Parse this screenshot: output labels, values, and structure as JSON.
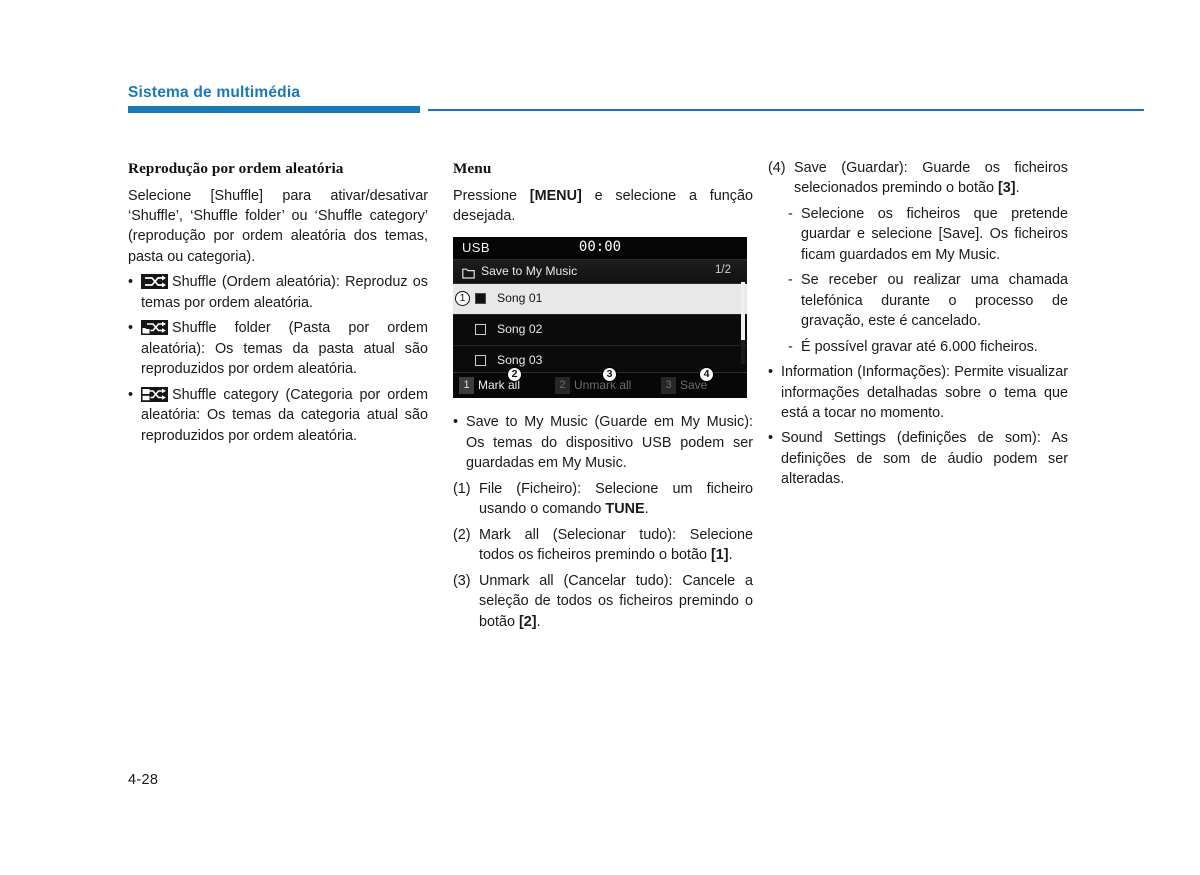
{
  "header": {
    "title": "Sistema de multimédia",
    "accent_color": "#1879b8"
  },
  "footer": {
    "page_number": "4-28"
  },
  "left_column": {
    "heading": "Reprodução por ordem aleatória",
    "intro": "Selecione [Shuffle] para ativar/desativar ‘Shuffle’, ‘Shuffle folder’ ou ‘Shuffle category’ (reprodução por ordem aleatória dos temas, pasta ou categoria).",
    "bullets": [
      {
        "icon": "shuffle-icon",
        "text": "Shuffle (Ordem aleatória): Reproduz os temas por ordem aleatória."
      },
      {
        "icon": "shuffle-folder-icon",
        "text": "Shuffle folder (Pasta por ordem aleatória): Os temas da pasta atual são reproduzidos por ordem aleatória."
      },
      {
        "icon": "shuffle-category-icon",
        "text": "Shuffle category (Categoria por ordem aleatória: Os temas da categoria atual são reproduzidos por ordem aleatória."
      }
    ]
  },
  "center_column": {
    "heading": "Menu",
    "intro_before": "Pressione ",
    "intro_key": "[MENU]",
    "intro_after": " e selecione a função desejada.",
    "usb_screen": {
      "source_label": "USB",
      "clock": "00:00",
      "folder_icon": "folder-icon",
      "path_label": "Save to My Music",
      "page_indicator": "1/2",
      "rows": [
        {
          "label": "Song 01",
          "checked": true,
          "selected": true,
          "callout": "1"
        },
        {
          "label": "Song 02",
          "checked": false,
          "selected": false,
          "callout": ""
        },
        {
          "label": "Song 03",
          "checked": false,
          "selected": false,
          "callout": ""
        }
      ],
      "toolbar": [
        {
          "key": "1",
          "label": "Mark all",
          "enabled": true,
          "callout": "2"
        },
        {
          "key": "2",
          "label": "Unmark all",
          "enabled": false,
          "callout": "3"
        },
        {
          "key": "3",
          "label": "Save",
          "enabled": false,
          "callout": "4"
        }
      ]
    },
    "bullets": [
      {
        "text": "Save to My Music (Guarde em My Music): Os temas do dispositivo USB podem ser guardadas em My Music."
      }
    ],
    "numbered": [
      {
        "num": "(1)",
        "before": "File (Ficheiro): Selecione um ficheiro usando o comando ",
        "kw": "TUNE",
        "after": "."
      },
      {
        "num": "(2)",
        "before": "Mark all (Selecionar tudo): Selecione todos os ficheiros premindo o botão ",
        "kw": "[1]",
        "after": "."
      },
      {
        "num": "(3)",
        "before": "Unmark all (Cancelar tudo): Cancele a seleção de todos os ficheiros premindo o botão ",
        "kw": "[2]",
        "after": "."
      }
    ]
  },
  "right_column": {
    "numbered": [
      {
        "num": "(4)",
        "before": "Save (Guardar): Guarde os ficheiros selecionados premindo o botão ",
        "kw": "[3]",
        "after": "."
      }
    ],
    "dashes": [
      {
        "text": "Selecione os ficheiros que pretende guardar e selecione [Save]. Os ficheiros ficam guardados em My Music."
      },
      {
        "text": "Se receber ou realizar uma chamada telefónica durante o processo de gravação, este é cancelado."
      },
      {
        "text": "É possível gravar até 6.000 ficheiros."
      }
    ],
    "bullets": [
      {
        "text": "Information (Informações): Permite visualizar informações detalhadas sobre o tema que está a tocar no momento."
      },
      {
        "text": "Sound Settings (definições de som): As definições de som de áudio podem ser alteradas."
      }
    ]
  }
}
